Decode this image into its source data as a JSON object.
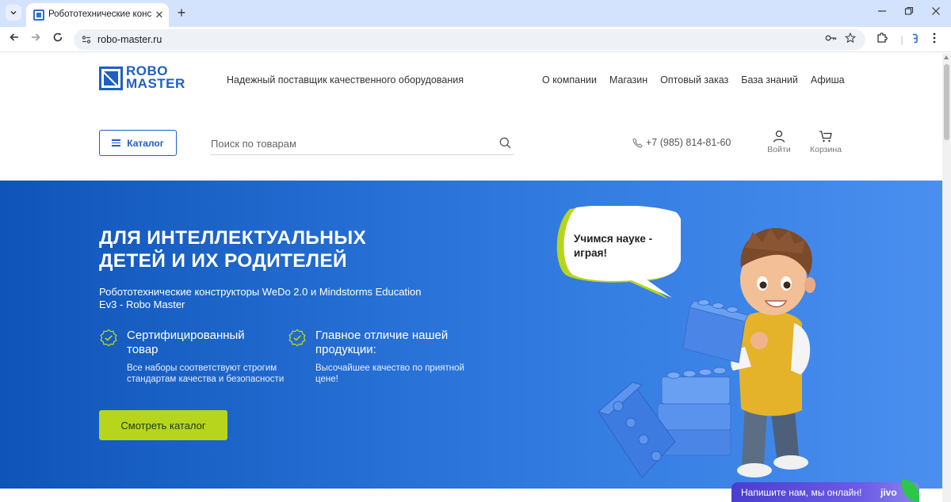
{
  "browser": {
    "tab_title": "Робототехнические конструкт",
    "url": "robo-master.ru",
    "new_tab_label": "+",
    "close_label": "✕"
  },
  "site": {
    "logo": {
      "line1": "ROBO",
      "line2": "MASTER"
    },
    "tagline": "Надежный поставщик качественного оборудования",
    "nav": [
      "О компании",
      "Магазин",
      "Оптовый заказ",
      "База знаний",
      "Афиша"
    ],
    "catalog_button": "Каталог",
    "search": {
      "placeholder": "Поиск по товарам"
    },
    "phone": "+7 (985) 814-81-60",
    "account": {
      "login": "Войти",
      "cart": "Корзина"
    }
  },
  "hero": {
    "title_line1": "ДЛЯ ИНТЕЛЛЕКТУАЛЬНЫХ",
    "title_line2": "ДЕТЕЙ И ИХ РОДИТЕЛЕЙ",
    "subtitle": "Робототехнические конструкторы WeDo 2.0 и Mindstorms Education Ev3 - Robo Master",
    "features": [
      {
        "title": "Сертифицированный товар",
        "desc": "Все наборы соответствуют строгим стандартам качества и безопасности"
      },
      {
        "title": "Главное отличие нашей продукции:",
        "desc": "Высочайшее качество по приятной цене!"
      }
    ],
    "cta": "Смотреть каталог",
    "bubble_text": "Учимся науке - играя!"
  },
  "chat": {
    "text": "Напишите нам, мы онлайн!",
    "brand": "jivo"
  },
  "colors": {
    "brand_blue": "#1f5fc6",
    "hero_start": "#0f54b9",
    "hero_end": "#4a8ff0",
    "cta_green": "#b6d51c",
    "chat_purple": "#4a3ed0"
  }
}
